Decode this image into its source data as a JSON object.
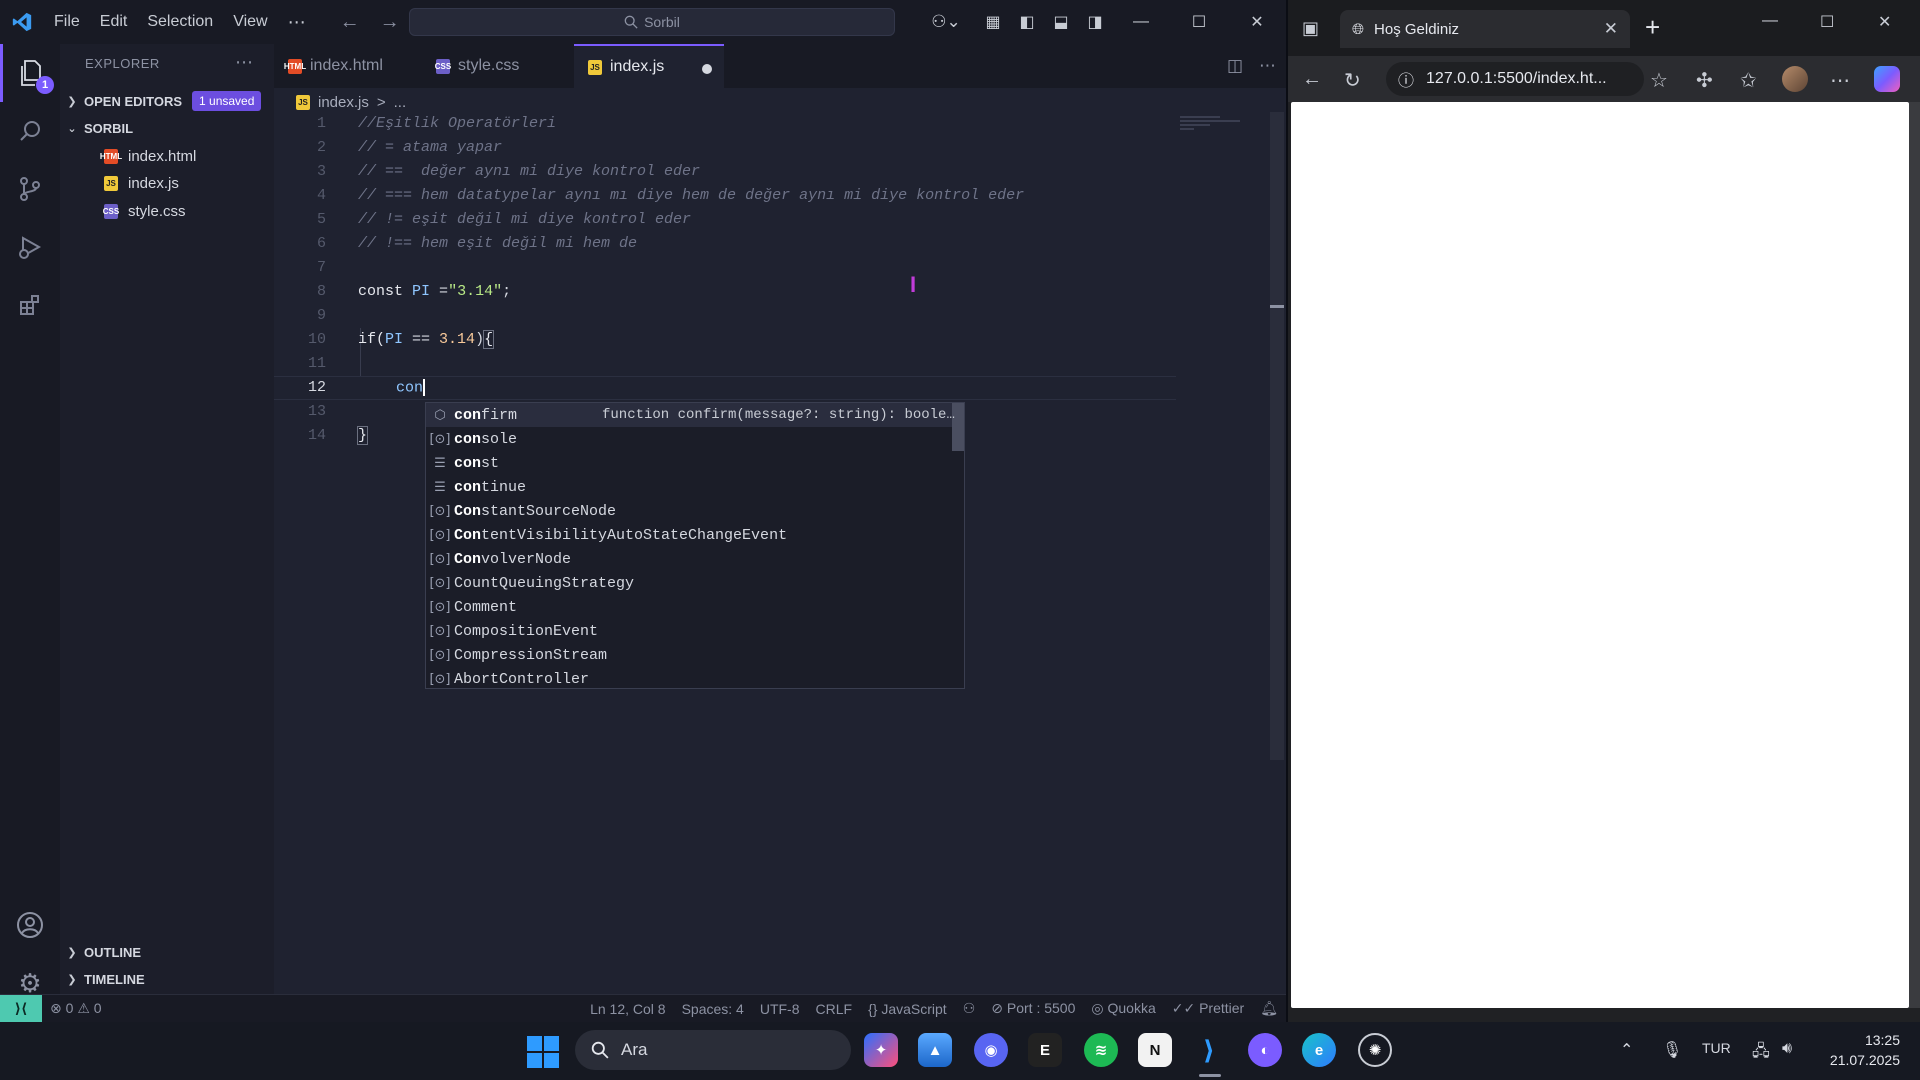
{
  "vscode": {
    "menu": [
      "File",
      "Edit",
      "Selection",
      "View"
    ],
    "menu_more": "⋯",
    "search_text": "Sorbil",
    "explorer_title": "EXPLORER",
    "activity_badge": "1",
    "open_editors": {
      "label": "OPEN EDITORS",
      "badge": "1 unsaved"
    },
    "folder": "SORBIL",
    "files": [
      {
        "name": "index.html",
        "icon": "html-file-icon",
        "type": "HTML"
      },
      {
        "name": "index.js",
        "icon": "js-file-icon",
        "type": "JS"
      },
      {
        "name": "style.css",
        "icon": "css-file-icon",
        "type": "CSS"
      }
    ],
    "tabs": [
      {
        "label": "index.html",
        "type": "HTML",
        "active": false
      },
      {
        "label": "style.css",
        "type": "CSS",
        "active": false
      },
      {
        "label": "index.js",
        "type": "JS",
        "active": true,
        "unsaved": true
      }
    ],
    "breadcrumb": {
      "file": "index.js",
      "sep": ">",
      "rest": "..."
    },
    "line_numbers": [
      "1",
      "2",
      "3",
      "4",
      "5",
      "6",
      "7",
      "8",
      "9",
      "10",
      "11",
      "12",
      "13",
      "14"
    ],
    "current_line": "12",
    "code": {
      "l1": "//Eşitlik Operatörleri",
      "l2": "// = atama yapar",
      "l3": "// ==  değer aynı mi diye kontrol eder",
      "l4": "// === hem datatypelar aynı mı diye hem de değer aynı mi diye kontrol eder",
      "l5": "// != eşit değil mi diye kontrol eder",
      "l6": "// !== hem eşit değil mi hem de",
      "l8_kw": "const",
      "l8_id": "PI",
      "l8_eq": " =",
      "l8_str": "\"3.14\"",
      "l8_end": ";",
      "l10_kw": "if(",
      "l10_id": "PI",
      "l10_op": " == ",
      "l10_num": "3.14",
      "l10_paren": ")",
      "l10_brace": "{",
      "l12_typed": "con",
      "l14_brace": "}"
    },
    "suggestions": [
      {
        "hl": "con",
        "rest": "firm",
        "icon": "method-icon",
        "detail": "function confirm(message?: string): boole…"
      },
      {
        "hl": "con",
        "rest": "sole",
        "icon": "variable-icon"
      },
      {
        "hl": "con",
        "rest": "st",
        "icon": "keyword-icon"
      },
      {
        "hl": "con",
        "rest": "tinue",
        "icon": "keyword-icon"
      },
      {
        "hl": "Con",
        "rest": "stantSourceNode",
        "icon": "variable-icon"
      },
      {
        "hl": "Con",
        "rest": "tentVisibilityAutoStateChangeEvent",
        "icon": "variable-icon"
      },
      {
        "hl": "Con",
        "rest": "volverNode",
        "icon": "variable-icon"
      },
      {
        "hl": "CountQueuingStrategy",
        "rest": "",
        "icon": "variable-icon"
      },
      {
        "hl": "Comment",
        "rest": "",
        "icon": "variable-icon"
      },
      {
        "hl": "CompositionEvent",
        "rest": "",
        "icon": "variable-icon"
      },
      {
        "hl": "CompressionStream",
        "rest": "",
        "icon": "variable-icon"
      },
      {
        "hl": "AbortController",
        "rest": "",
        "icon": "variable-icon"
      }
    ],
    "outline": "OUTLINE",
    "timeline": "TIMELINE",
    "status": {
      "errors": "0",
      "warnings": "0",
      "position": "Ln 12, Col 8",
      "spaces": "Spaces: 4",
      "encoding": "UTF-8",
      "eol": "CRLF",
      "language": "JavaScript",
      "port": "Port : 5500",
      "quokka": "Quokka",
      "prettier": "Prettier"
    }
  },
  "browser": {
    "tab_title": "Hoş Geldiniz",
    "url": "127.0.0.1:5500/index.ht..."
  },
  "taskbar": {
    "search_placeholder": "Ara",
    "language": "TUR",
    "time": "13:25",
    "date": "21.07.2025"
  },
  "colors": {
    "accent": "#7b5cff",
    "remote": "#4ec9b0",
    "cursor_ibeam": "#c13cd9"
  }
}
